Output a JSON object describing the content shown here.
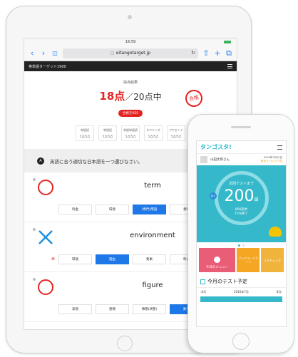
{
  "ipad": {
    "status": {
      "time": "16:59"
    },
    "browser": {
      "back": "‹",
      "forward": "›",
      "bookmarks": "📖",
      "url": "eitangotarget.jp",
      "lock": "🔒",
      "reload": "↻",
      "share": "⇧",
      "add": "+",
      "tabs": "⧉"
    },
    "header": {
      "title": "英単語ターゲット1900"
    },
    "result": {
      "label": "採点結果",
      "score": "18点",
      "max": "／20点中",
      "retry": "合格をRES",
      "stamp": "合格"
    },
    "skills": [
      {
        "name": "単語読",
        "score": "5点/5点"
      },
      {
        "name": "単語読",
        "score": "5点/5点"
      },
      {
        "name": "単語単語読",
        "score": "5点/5点"
      },
      {
        "name": "スペリング",
        "score": "5点/5点"
      },
      {
        "name": "アクセント",
        "score": "5点/5点"
      }
    ],
    "instruction": {
      "badge": "A",
      "text": "英語に合う適切な日本語を一つ選びなさい。"
    },
    "questions": [
      {
        "mark": "correct",
        "word": "term",
        "choices": [
          "料金",
          "環境",
          "(専門)用語",
          "意味"
        ],
        "selected": 2,
        "wrong": null
      },
      {
        "mark": "incorrect",
        "word": "environment",
        "choices": [
          "環境",
          "理由",
          "要素",
          "料金"
        ],
        "selected": 1,
        "wrong": 0
      },
      {
        "mark": "correct",
        "word": "figure",
        "choices": [
          "表現",
          "感情",
          "事態(状態)",
          "数字"
        ],
        "selected": 3,
        "wrong": null
      }
    ]
  },
  "phone": {
    "logo": "タンゴスタ!",
    "user": {
      "name": "山田太郎さん",
      "date": "2016年7月20日",
      "rank": "総合ランキング7位"
    },
    "hero": {
      "next": "次回テストまで",
      "count": "200",
      "unit": "語",
      "progress": "800語中",
      "percent": "75%終了",
      "tag": "あと"
    },
    "menu": {
      "main": "今日のメニュー",
      "side1": "ブックマークカード",
      "side2": "ミスチェック"
    },
    "schedule": {
      "title": "今月のテスト予定",
      "prev": "‹6月",
      "current": "2016年7月",
      "next": "8月›"
    },
    "colors": {
      "accent": "#35b8c9",
      "red": "#e52424",
      "blue": "#1f78e8"
    }
  }
}
